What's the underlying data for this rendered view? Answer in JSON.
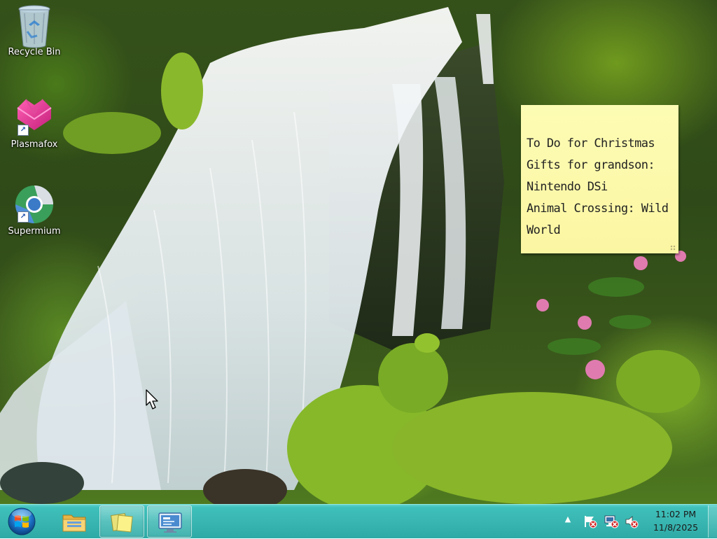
{
  "desktop": {
    "icons": [
      {
        "label": "Recycle Bin",
        "icon": "recycle-bin-icon"
      },
      {
        "label": "Plasmafox",
        "icon": "plasmafox-icon"
      },
      {
        "label": "Supermium",
        "icon": "supermium-icon"
      }
    ]
  },
  "sticky_note": {
    "lines": [
      "To Do for Christmas",
      "Gifts for grandson:",
      "Nintendo DSi",
      "Animal Crossing: Wild",
      "World"
    ]
  },
  "taskbar": {
    "start_icon": "windows-start-orb-icon",
    "pinned": [
      {
        "name": "windows-explorer",
        "icon": "folder-icon",
        "active": false
      },
      {
        "name": "sticky-notes",
        "icon": "sticky-notes-icon",
        "active": true
      },
      {
        "name": "remote-desktop",
        "icon": "remote-desktop-icon",
        "active": true
      }
    ],
    "tray": {
      "icons": [
        "show-hidden-icons-chevron",
        "action-center-flag-icon",
        "network-icon",
        "volume-muted-icon"
      ],
      "time": "11:02 PM",
      "date": "11/8/2025"
    }
  },
  "colors": {
    "taskbar": "#39b6b1",
    "sticky_note": "#fbf6a2"
  }
}
